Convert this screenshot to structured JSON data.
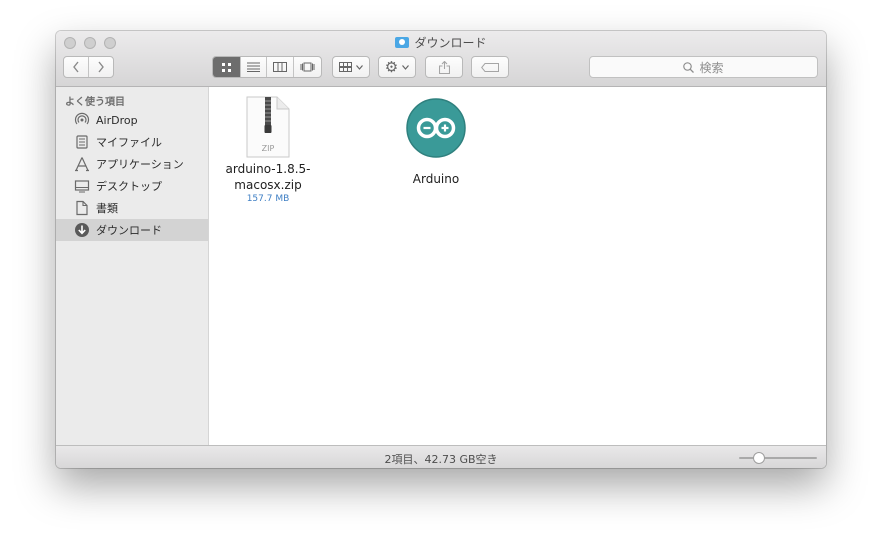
{
  "window": {
    "title": "ダウンロード"
  },
  "toolbar": {
    "back_icon": "chevron-left-icon",
    "forward_icon": "chevron-right-icon",
    "view_modes": [
      "icon-view",
      "list-view",
      "column-view",
      "cover-flow-view"
    ],
    "active_view": "icon-view",
    "search_placeholder": "検索"
  },
  "sidebar": {
    "header": "よく使う項目",
    "items": [
      {
        "label": "AirDrop",
        "icon": "airdrop-icon"
      },
      {
        "label": "マイファイル",
        "icon": "all-my-files-icon"
      },
      {
        "label": "アプリケーション",
        "icon": "applications-icon"
      },
      {
        "label": "デスクトップ",
        "icon": "desktop-icon"
      },
      {
        "label": "書類",
        "icon": "documents-icon"
      },
      {
        "label": "ダウンロード",
        "icon": "downloads-icon"
      }
    ],
    "selected_index": 5
  },
  "files": [
    {
      "name_line1": "arduino-1.8.5-",
      "name_line2": "macosx.zip",
      "size": "157.7 MB",
      "icon_label": "ZIP"
    },
    {
      "name_line1": "Arduino",
      "icon": "arduino-app-icon"
    }
  ],
  "status": {
    "text": "2項目、42.73 GB空き",
    "zoom_level": 0.25
  },
  "colors": {
    "arduino_teal": "#3a9a98",
    "selection": "#d3d3d3",
    "size_text": "#3f7fc4"
  }
}
